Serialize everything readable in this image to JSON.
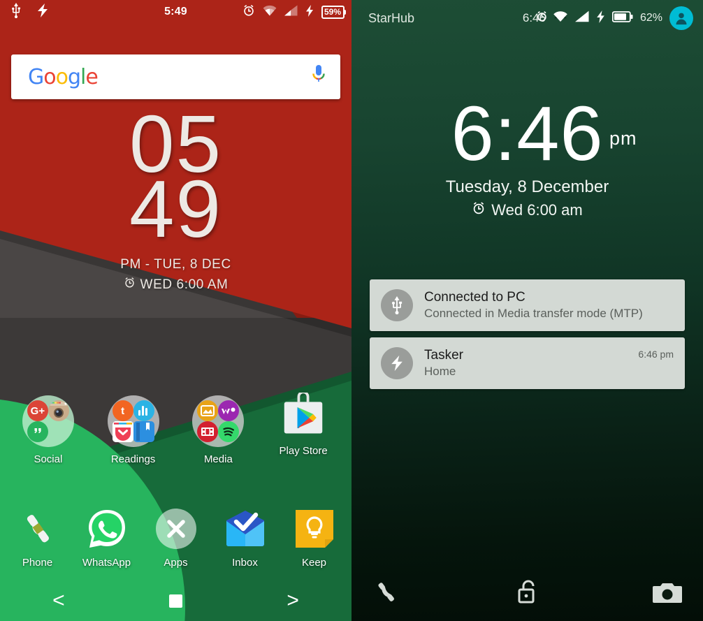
{
  "home": {
    "status_bar": {
      "left_icons": [
        "usb-icon",
        "tasker-bolt-icon"
      ],
      "clock": "5:49",
      "right_icons": [
        "alarm-icon",
        "wifi-icon",
        "signal-icon",
        "charging-bolt-icon"
      ],
      "battery_percent": "59%"
    },
    "search": {
      "logo": "Google",
      "mic_icon": "microphone-icon"
    },
    "clock_widget": {
      "hours": "05",
      "minutes": "49",
      "date": "PM - TUE, 8 DEC",
      "alarm_icon": "alarm-icon",
      "alarm": "WED 6:00 AM"
    },
    "folders": [
      {
        "label": "Social",
        "kind": "folder",
        "bubble": "greenish",
        "apps": [
          "google-plus-icon",
          "instagram-icon",
          "hangouts-icon",
          ""
        ]
      },
      {
        "label": "Readings",
        "kind": "folder",
        "bubble": "grey",
        "apps": [
          "tumblr-icon",
          "feedly-icon",
          "pocket-icon",
          "book-icon"
        ]
      },
      {
        "label": "Media",
        "kind": "folder",
        "bubble": "grey",
        "apps": [
          "photos-icon",
          "walkman-icon",
          "movies-icon",
          "spotify-icon"
        ]
      },
      {
        "label": "Play Store",
        "kind": "app",
        "icon": "play-store-icon"
      }
    ],
    "dock": [
      {
        "label": "Phone",
        "icon": "phone-handset-icon"
      },
      {
        "label": "WhatsApp",
        "icon": "whatsapp-icon"
      },
      {
        "label": "Apps",
        "icon": "apps-x-icon"
      },
      {
        "label": "Inbox",
        "icon": "inbox-envelope-icon"
      },
      {
        "label": "Keep",
        "icon": "keep-bulb-icon"
      }
    ],
    "navbar": [
      {
        "name": "back-button",
        "glyph": "<"
      },
      {
        "name": "home-button",
        "glyph": ""
      },
      {
        "name": "recents-button",
        "glyph": ">"
      }
    ]
  },
  "lock": {
    "status_bar": {
      "carrier": "StarHub",
      "clock": "6:46",
      "alarm_overlay_icon": "alarm-icon",
      "right_icons": [
        "wifi-icon",
        "signal-icon",
        "charging-bolt-icon",
        "battery-icon"
      ],
      "battery_percent": "62%",
      "avatar_icon": "user-avatar-icon"
    },
    "clock": {
      "time": "6:46",
      "ampm": "pm",
      "date": "Tuesday, 8 December",
      "alarm_icon": "alarm-icon",
      "alarm": "Wed 6:00 am"
    },
    "notifications": [
      {
        "icon": "usb-icon",
        "title": "Connected to PC",
        "text": "Connected in Media transfer mode (MTP)",
        "time": ""
      },
      {
        "icon": "tasker-bolt-icon",
        "title": "Tasker",
        "text": "Home",
        "time": "6:46 pm"
      }
    ],
    "shortcuts": [
      {
        "name": "phone-shortcut",
        "icon": "phone-handset-icon"
      },
      {
        "name": "unlock-shortcut",
        "icon": "unlock-padlock-icon"
      },
      {
        "name": "camera-shortcut",
        "icon": "camera-icon"
      }
    ]
  },
  "colors": {
    "wallpaper_red": "#AC2418",
    "wallpaper_grey": "#4a4645",
    "wallpaper_green_light": "#27B45E",
    "wallpaper_green_dark": "#176B3A",
    "lock_bg_top": "#1d4d35",
    "lock_bg_bottom": "#030e07",
    "avatar_cyan": "#00BCD4",
    "notif_card": "#d3d9d4"
  }
}
